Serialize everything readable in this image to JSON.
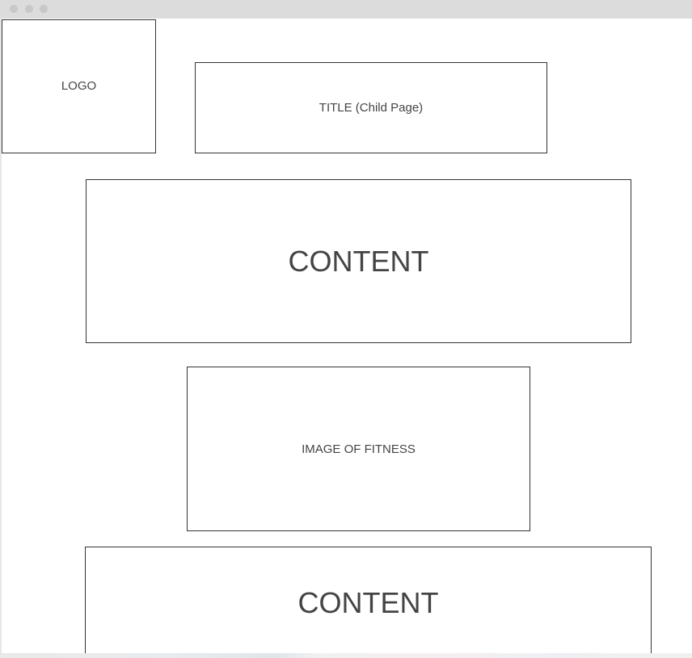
{
  "window": {
    "controls": [
      "close",
      "minimize",
      "maximize"
    ]
  },
  "wireframe": {
    "logo_label": "LOGO",
    "title_label": "TITLE (Child Page)",
    "content_label_1": "CONTENT",
    "image_label": "IMAGE OF FITNESS",
    "content_label_2": "CONTENT"
  }
}
